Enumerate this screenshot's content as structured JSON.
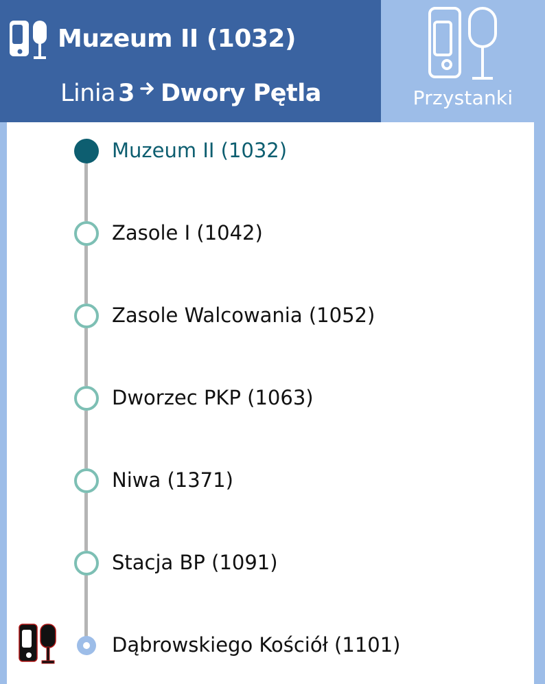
{
  "header": {
    "stop_title": "Muzeum II (1032)",
    "line_prefix": "Linia",
    "line_number": "3",
    "direction": "Dwory Pętla",
    "icon": "bus-stop-icon",
    "arrow_icon": "arrow-right-icon"
  },
  "stops_button": {
    "label": "Przystanki",
    "icon": "bus-stop-icon"
  },
  "stops": [
    {
      "label": "Muzeum II (1032)",
      "state": "current"
    },
    {
      "label": "Zasole I (1042)",
      "state": "upcoming"
    },
    {
      "label": "Zasole Walcowania (1052)",
      "state": "upcoming"
    },
    {
      "label": "Dworzec PKP (1063)",
      "state": "upcoming"
    },
    {
      "label": "Niwa (1371)",
      "state": "upcoming"
    },
    {
      "label": "Stacja BP (1091)",
      "state": "upcoming"
    },
    {
      "label": "Dąbrowskiego Kościół (1101)",
      "state": "vehicle-here"
    }
  ],
  "vehicle_marker": {
    "icon": "bus-stop-icon",
    "stop": "Dąbrowskiego Kościół (1101)"
  },
  "colors": {
    "header_bg": "#3a63a1",
    "button_bg": "#9dbde8",
    "current_stop": "#0d5e70",
    "stop_ring": "#7dbfb4",
    "connector": "#b5b5b5"
  }
}
